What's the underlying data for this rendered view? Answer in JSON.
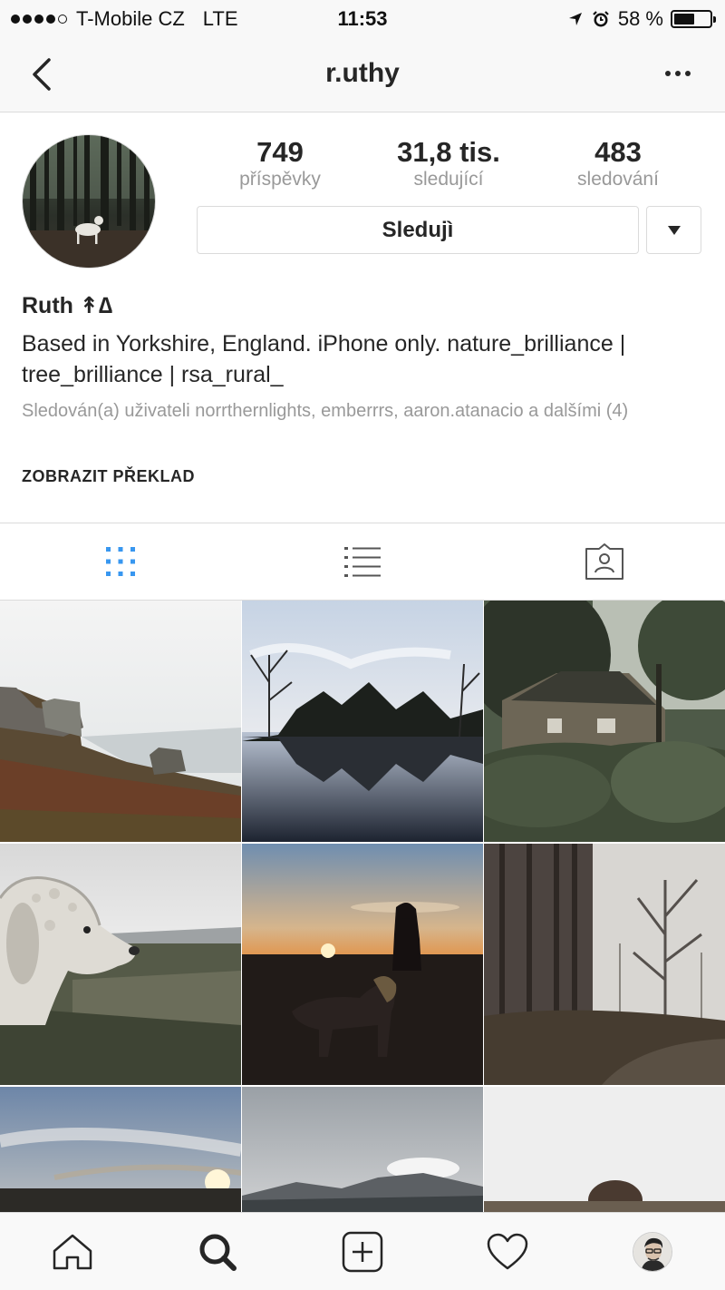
{
  "status_bar": {
    "carrier": "T-Mobile CZ",
    "network": "LTE",
    "time": "11:53",
    "battery": "58 %",
    "battery_level": 0.58,
    "signal_bars": 4,
    "signal_max": 5
  },
  "nav": {
    "title": "r.uthy"
  },
  "profile": {
    "stats": [
      {
        "value": "749",
        "label": "příspěvky"
      },
      {
        "value": "31,8 tis.",
        "label": "sledující"
      },
      {
        "value": "483",
        "label": "sledování"
      }
    ],
    "follow_label": "Sledujì",
    "name": "Ruth ↟∆",
    "bio": "Based in Yorkshire, England. iPhone only. nature_brilliance | tree_brilliance | rsa_rural_",
    "followed_by": "Sledován(a) uživateli norrthernlights, emberrrs, aaron.atanacio a dalšími (4)",
    "translate_label": "ZOBRAZIT PŘEKLAD"
  },
  "tabs": [
    {
      "icon": "grid-icon",
      "active": true
    },
    {
      "icon": "list-icon",
      "active": false
    },
    {
      "icon": "tagged-icon",
      "active": false
    }
  ],
  "colors": {
    "accent": "#3897f0",
    "icon": "#262626",
    "muted": "#999999",
    "border": "#dbdbdb"
  },
  "grid": [
    "photo-rocky-hillside",
    "photo-lake-reflection",
    "photo-forest-cottage",
    "photo-curly-dog",
    "photo-sunset-silhouette",
    "photo-misty-trees",
    "photo-sunrise-sky",
    "photo-misty-hills",
    "photo-foggy-field"
  ],
  "bottom_nav": [
    {
      "icon": "home-icon"
    },
    {
      "icon": "search-icon"
    },
    {
      "icon": "add-post-icon"
    },
    {
      "icon": "heart-icon"
    },
    {
      "icon": "profile-avatar"
    }
  ]
}
